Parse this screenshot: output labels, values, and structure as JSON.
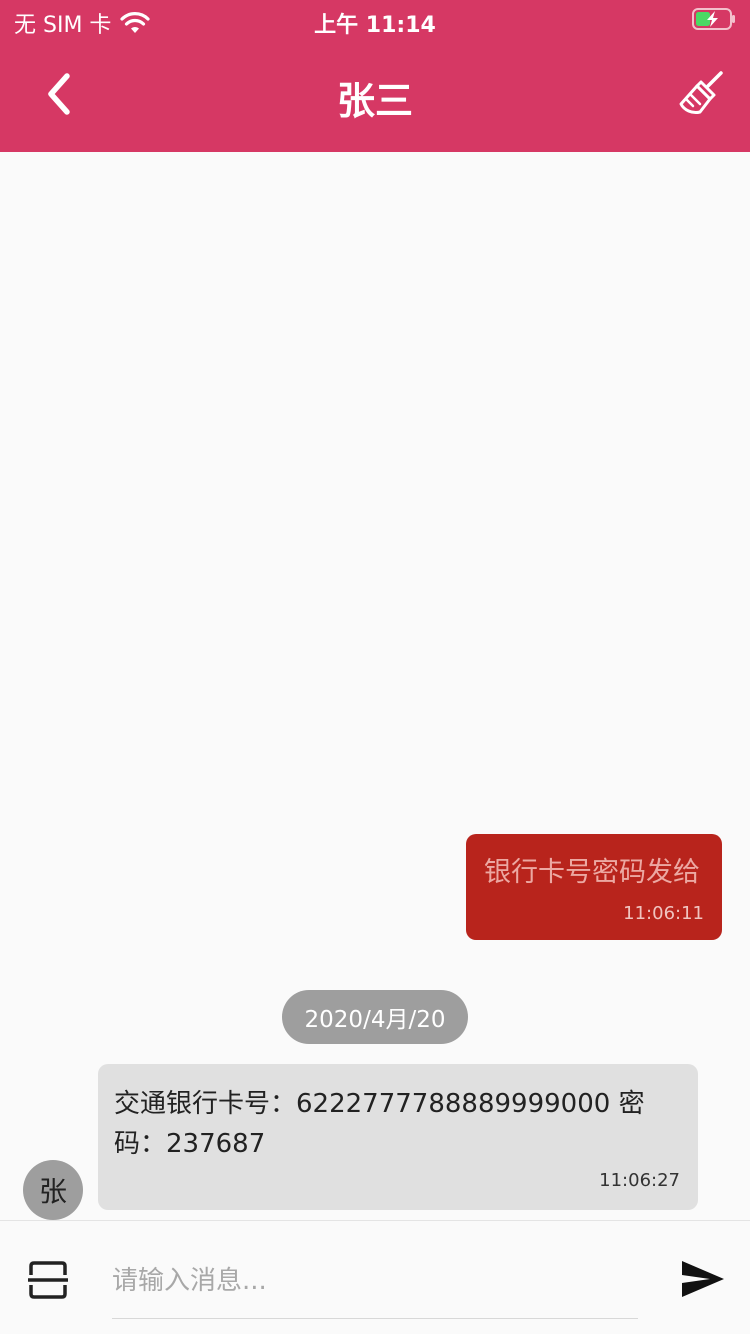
{
  "status_bar": {
    "carrier": "无 SIM 卡",
    "time": "上午 11:14",
    "wifi_icon": "wifi-icon",
    "battery_icon": "battery-charging-icon"
  },
  "header": {
    "title": "张三",
    "back_icon": "chevron-left-icon",
    "clear_icon": "broom-icon",
    "color": "#d63864"
  },
  "messages": {
    "outgoing": {
      "text": "银行卡号密码发给",
      "time": "11:06:11",
      "color": "#b8241c"
    },
    "date_divider": "2020/4月/20",
    "incoming": {
      "avatar_text": "张",
      "text": "交通银行卡号：6222777788889999000 密码：237687",
      "time": "11:06:27"
    }
  },
  "input_bar": {
    "placeholder": "请输入消息...",
    "value": "",
    "scan_icon": "scan-icon",
    "send_icon": "send-icon"
  }
}
